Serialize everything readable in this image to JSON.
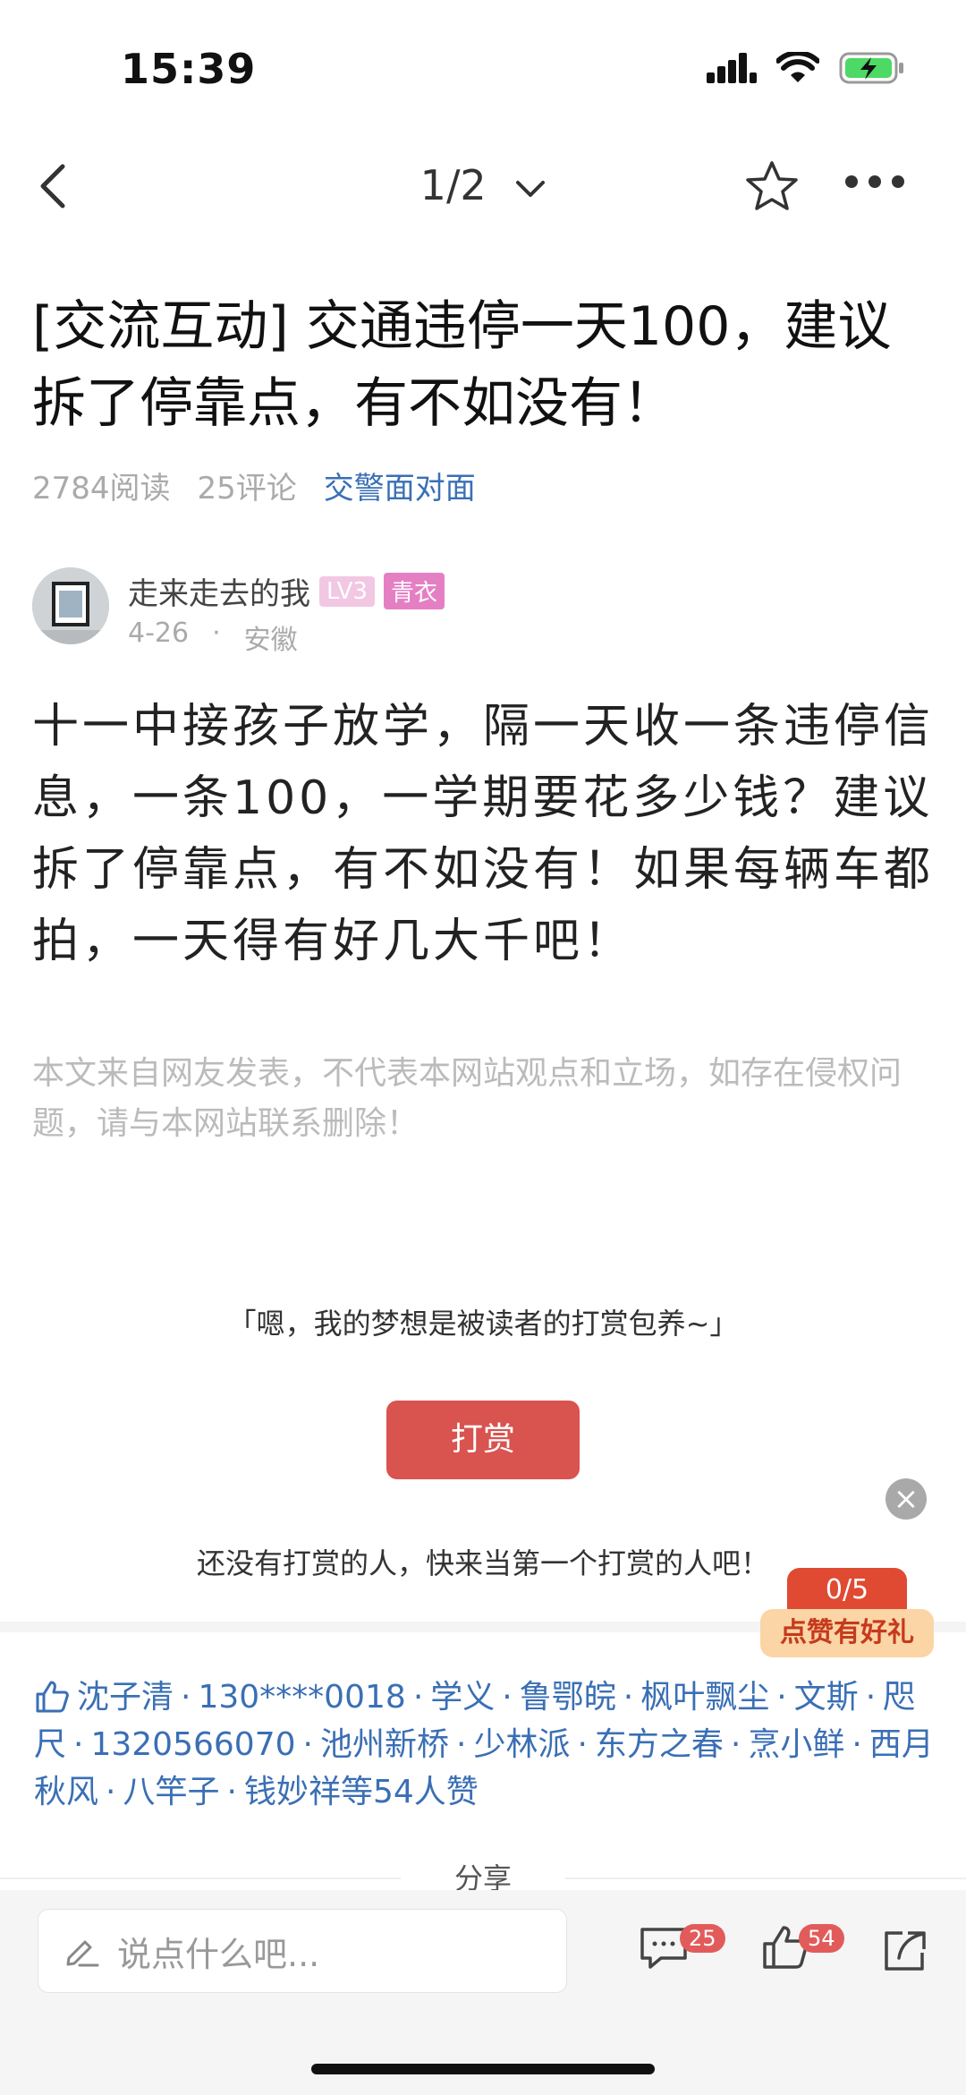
{
  "status": {
    "time": "15:39"
  },
  "nav": {
    "page_indicator": "1/2"
  },
  "post": {
    "title": "[交流互动] 交通违停一天100，建议拆了停靠点，有不如没有！",
    "reads": "2784阅读",
    "comments": "25评论",
    "topic": "交警面对面"
  },
  "author": {
    "name": "走来走去的我",
    "level_badge": "LV3",
    "rank_badge": "青衣",
    "date": "4-26",
    "dot": "·",
    "location": "安徽"
  },
  "content": {
    "body": "十一中接孩子放学，隔一天收一条违停信息，一条100，一学期要花多少钱？建议拆了停靠点，有不如没有！如果每辆车都拍，一天得有好几大千吧！",
    "disclaimer": "本文来自网友发表，不代表本网站观点和立场，如存在侵权问题，请与本网站联系删除！"
  },
  "reward": {
    "quote": "「嗯，我的梦想是被读者的打赏包养~」",
    "button": "打赏",
    "empty_text": "还没有打赏的人，快来当第一个打赏的人吧！",
    "close": "×"
  },
  "promo": {
    "count": "0/5",
    "label": "点赞有好礼"
  },
  "likes": {
    "names": [
      "沈子清",
      "130****0018",
      "学义",
      "鲁鄂皖",
      "枫叶飘尘",
      "文斯",
      "咫尺",
      "1320566070",
      "池州新桥",
      "少林派",
      "东方之春",
      "烹小鲜",
      "西月秋风",
      "八竿子",
      "钱妙祥等54人赞"
    ]
  },
  "share_label": "分享",
  "bottom": {
    "input_placeholder": "说点什么吧...",
    "comment_count": "25",
    "like_count": "54"
  }
}
